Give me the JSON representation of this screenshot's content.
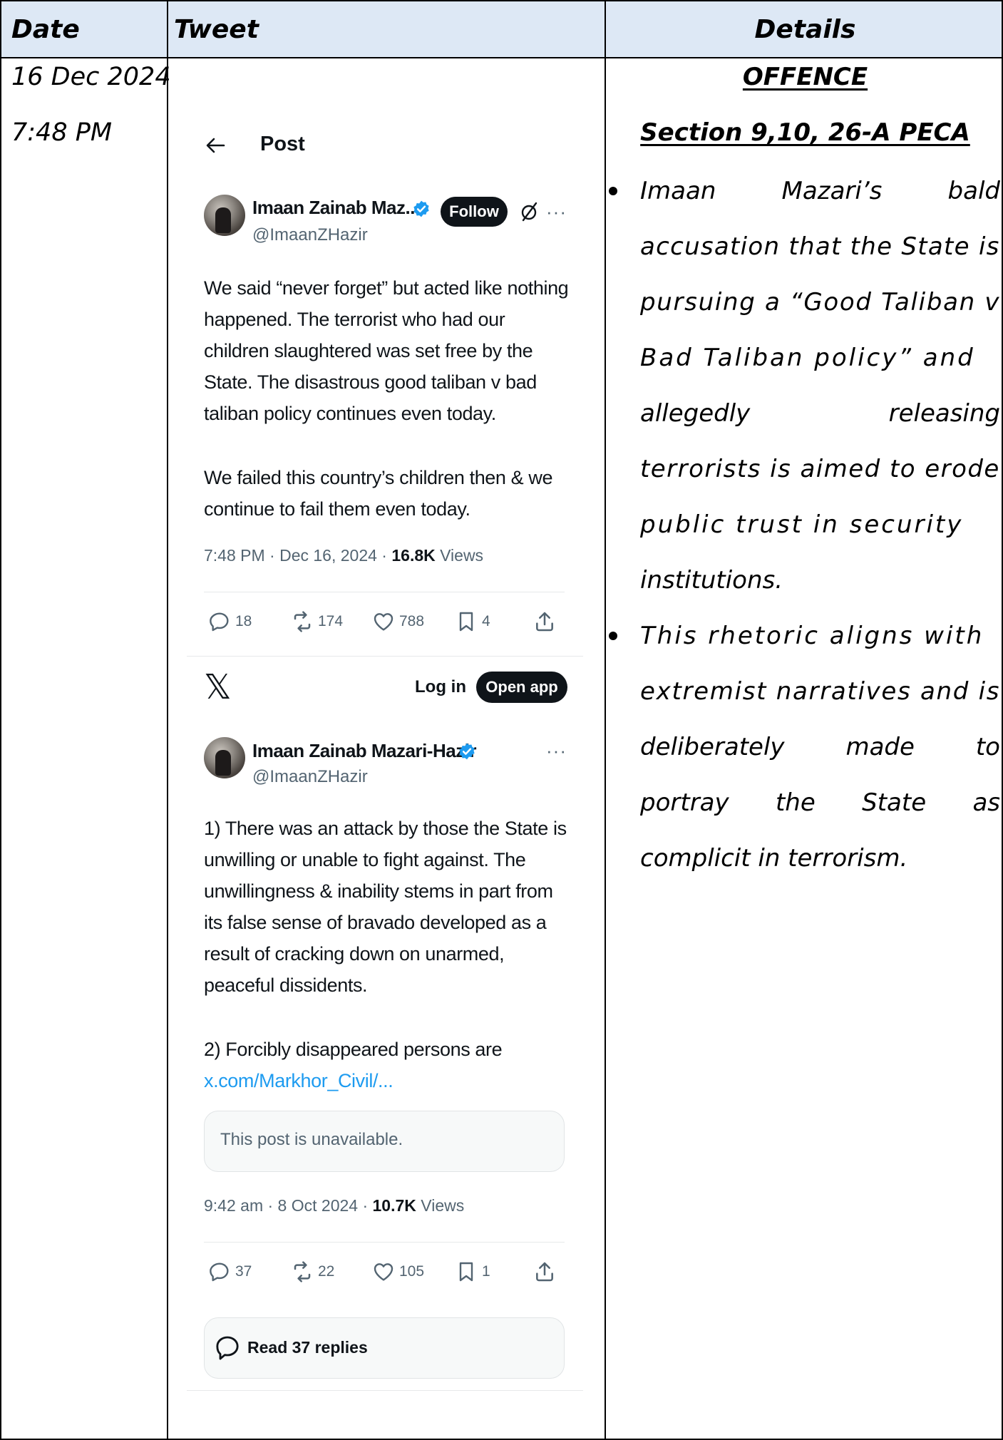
{
  "table": {
    "headers": {
      "date": "Date",
      "tweet": "Tweet",
      "details": "Details"
    }
  },
  "date": {
    "day": "16 Dec 2024",
    "time": "7:48 PM"
  },
  "tweet1": {
    "back_label": "Post",
    "name": "Imaan Zainab Maz...",
    "handle": "@ImaanZHazir",
    "follow_label": "Follow",
    "lines": [
      "We said “never forget” but acted like nothing",
      "happened. The terrorist who had our",
      "children slaughtered was set free by the",
      "State. The disastrous good taliban v bad",
      "taliban policy continues even today.",
      "We failed this country’s children then & we",
      "continue to fail them even today."
    ],
    "timestamp": "7:48 PM · Dec 16, 2024 · ",
    "views_count": "16.8K",
    "views_label": "Views",
    "replies": "18",
    "reposts": "174",
    "likes": "788",
    "bookmarks": "4"
  },
  "topbar": {
    "login_label": "Log in",
    "open_app_label": "Open app"
  },
  "tweet2": {
    "name": "Imaan Zainab Mazari-Hazir",
    "handle": "@ImaanZHazir",
    "lines": [
      "1) There was an attack by those the State is",
      "unwilling or unable to fight against. The",
      "unwillingness & inability stems in part from",
      "its false sense of bravado developed as a",
      "result of cracking down on unarmed,",
      "peaceful dissidents.",
      "2) Forcibly disappeared persons are"
    ],
    "link": "x.com/Markhor_Civil/...",
    "unavailable": "This post is unavailable.",
    "timestamp": "9:42 am · 8 Oct 2024 · ",
    "views_count": "10.7K",
    "views_label": "Views",
    "replies": "37",
    "reposts": "22",
    "likes": "105",
    "bookmarks": "1",
    "read_replies": "Read 37 replies"
  },
  "details": {
    "heading1": "OFFENCE",
    "heading2": "Section 9,10, 26-A PECA",
    "bullet1": [
      [
        "Imaan",
        "Mazari’s",
        "bald"
      ],
      [
        "accusation that the State is"
      ],
      [
        "pursuing a “Good Taliban v"
      ],
      [
        "Bad Taliban policy” and"
      ],
      [
        "allegedly",
        "releasing"
      ],
      [
        "terrorists is aimed to erode"
      ],
      [
        "public trust in security"
      ],
      [
        "institutions."
      ]
    ],
    "bullet2": [
      [
        "This rhetoric aligns with"
      ],
      [
        "extremist narratives and is"
      ],
      [
        "deliberately",
        "made",
        "to"
      ],
      [
        "portray",
        "the",
        "State",
        "as"
      ],
      [
        "complicit in terrorism."
      ]
    ]
  },
  "colors": {
    "header_bg": "#dde8f5",
    "verified_blue": "#1d9bf0",
    "link_blue": "#1d9bf0",
    "x_text": "#0f1419",
    "x_gray": "#536471"
  },
  "icons": [
    "back-arrow-icon",
    "verified-badge-icon",
    "grok-icon",
    "more-icon",
    "reply-icon",
    "repost-icon",
    "like-icon",
    "bookmark-icon",
    "share-icon",
    "x-logo-icon",
    "replies-bubble-icon"
  ]
}
